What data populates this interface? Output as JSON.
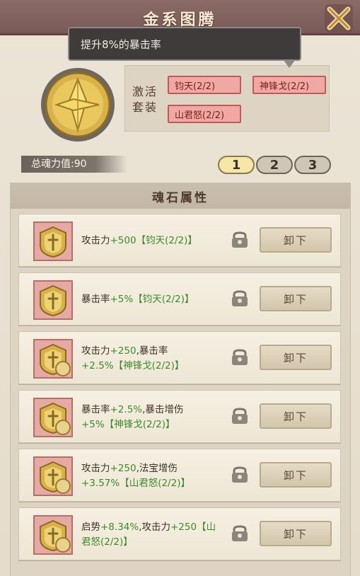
{
  "window": {
    "title": "金系图腾"
  },
  "tooltip": {
    "text": "提升8%的暴击率"
  },
  "set_bonus": {
    "label_line1": "激活",
    "label_line2": "套装",
    "tags": [
      "钧天(2/2)",
      "神锋戈(2/2)",
      "山君怒(2/2)"
    ]
  },
  "total_power": {
    "label": "总魂力值:90"
  },
  "pages": {
    "items": [
      "1",
      "2",
      "3"
    ],
    "active": "1"
  },
  "section": {
    "title": "魂石属性"
  },
  "rows": [
    {
      "line1_a": "攻击力",
      "line1_g": "+500【钧天(2/2)】",
      "line1_b": "",
      "line2_g": "",
      "button": "卸下"
    },
    {
      "line1_a": "暴击率",
      "line1_g": "+5%【钧天(2/2)】",
      "line1_b": "",
      "line2_g": "",
      "button": "卸下"
    },
    {
      "line1_a": "攻击力",
      "line1_g": "+250",
      "line1_b": ",暴击率",
      "line2_g": "+2.5%【神锋戈(2/2)】",
      "button": "卸下"
    },
    {
      "line1_a": "暴击率",
      "line1_g": "+2.5%",
      "line1_b": ",暴击增伤",
      "line2_g": "+5%【神锋戈(2/2)】",
      "button": "卸下"
    },
    {
      "line1_a": "攻击力",
      "line1_g": "+250",
      "line1_b": ",法宝增伤",
      "line2_g": "+3.57%【山君怒(2/2)】",
      "button": "卸下"
    },
    {
      "line1_a": "启势",
      "line1_g": "+8.34%",
      "line1_b": ",攻击力",
      "line1_g2": "+250【山",
      "line2_g": "君怒(2/2)】",
      "button": "卸下"
    }
  ],
  "colors": {
    "accent_green": "#3c8b2a",
    "tag_red": "#f0a8a4",
    "title_bar": "#7a5a57"
  },
  "icons": {
    "close": "close-icon",
    "emblem": "gold-totem-icon",
    "lock": "lock-icon",
    "stone": "soul-stone-icon"
  }
}
